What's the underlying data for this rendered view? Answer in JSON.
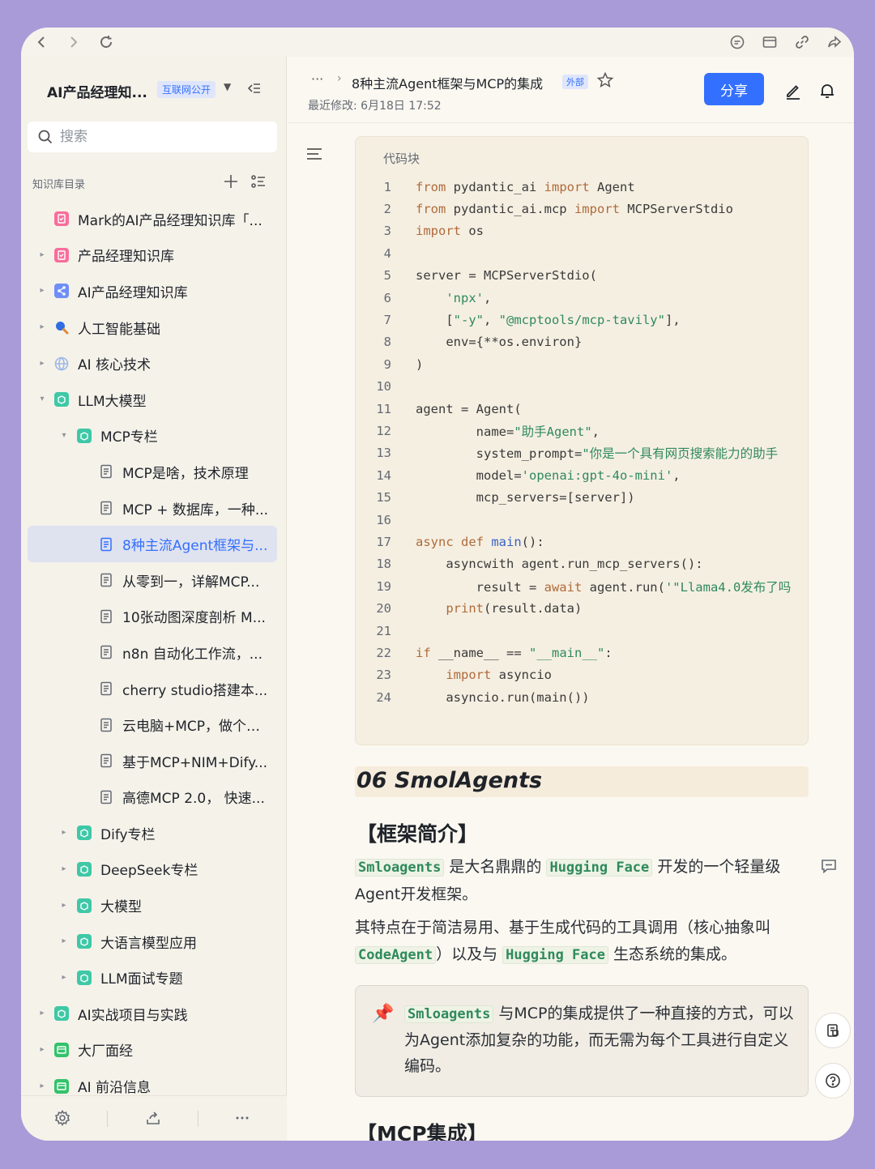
{
  "sidebar": {
    "kb_title": "AI产品经理知...",
    "kb_badge": "互联网公开",
    "search_placeholder": "搜索",
    "dir_title": "知识库目录",
    "items": [
      {
        "label": "Mark的AI产品经理知识库「...",
        "level": 1,
        "icon": "doc-pink-icon",
        "color": "#f76e9b",
        "arrow": ""
      },
      {
        "label": "产品经理知识库",
        "level": 1,
        "icon": "doc-pink-icon",
        "color": "#f76e9b",
        "arrow": "▸"
      },
      {
        "label": "AI产品经理知识库",
        "level": 1,
        "icon": "share-node-icon",
        "color": "#6f8ef7",
        "arrow": "▸"
      },
      {
        "label": "人工智能基础",
        "level": 1,
        "icon": "magnifier-icon",
        "color": "#2f6de0",
        "arrow": "▸"
      },
      {
        "label": "AI 核心技术",
        "level": 1,
        "icon": "globe-icon",
        "color": "#9db8e8",
        "arrow": "▸"
      },
      {
        "label": "LLM大模型",
        "level": 1,
        "icon": "folder-green-icon",
        "color": "#3ec8a6",
        "arrow": "▾"
      },
      {
        "label": "MCP专栏",
        "level": 2,
        "icon": "folder-green-icon",
        "color": "#3ec8a6",
        "arrow": "▾"
      },
      {
        "label": "MCP是啥，技术原理",
        "level": 3,
        "icon": "doc-icon",
        "color": "",
        "arrow": ""
      },
      {
        "label": "MCP + 数据库，一种...",
        "level": 3,
        "icon": "doc-icon",
        "color": "",
        "arrow": ""
      },
      {
        "label": "8种主流Agent框架与...",
        "level": 3,
        "icon": "doc-icon",
        "color": "#3370ff",
        "arrow": "",
        "active": true
      },
      {
        "label": "从零到一，详解MCP...",
        "level": 3,
        "icon": "doc-icon",
        "color": "",
        "arrow": ""
      },
      {
        "label": "10张动图深度剖析 M...",
        "level": 3,
        "icon": "doc-icon",
        "color": "",
        "arrow": ""
      },
      {
        "label": "n8n 自动化工作流，...",
        "level": 3,
        "icon": "doc-icon",
        "color": "",
        "arrow": ""
      },
      {
        "label": "cherry studio搭建本...",
        "level": 3,
        "icon": "doc-icon",
        "color": "",
        "arrow": ""
      },
      {
        "label": "云电脑+MCP，做个m...",
        "level": 3,
        "icon": "doc-icon",
        "color": "",
        "arrow": ""
      },
      {
        "label": "基于MCP+NIM+Dify...",
        "level": 3,
        "icon": "doc-icon",
        "color": "",
        "arrow": ""
      },
      {
        "label": "高德MCP 2.0， 快速...",
        "level": 3,
        "icon": "doc-icon",
        "color": "",
        "arrow": ""
      },
      {
        "label": "Dify专栏",
        "level": 2,
        "icon": "folder-green-icon",
        "color": "#3ec8a6",
        "arrow": "▸"
      },
      {
        "label": "DeepSeek专栏",
        "level": 2,
        "icon": "folder-green-icon",
        "color": "#3ec8a6",
        "arrow": "▸"
      },
      {
        "label": "大模型",
        "level": 2,
        "icon": "folder-green-icon",
        "color": "#3ec8a6",
        "arrow": "▸"
      },
      {
        "label": "大语言模型应用",
        "level": 2,
        "icon": "folder-green-icon",
        "color": "#3ec8a6",
        "arrow": "▸"
      },
      {
        "label": "LLM面试专题",
        "level": 2,
        "icon": "folder-green-icon",
        "color": "#3ec8a6",
        "arrow": "▸"
      },
      {
        "label": "AI实战项目与实践",
        "level": 1,
        "icon": "folder-green-icon",
        "color": "#3ec8a6",
        "arrow": "▸"
      },
      {
        "label": "大厂面经",
        "level": 1,
        "icon": "calendar-green-icon",
        "color": "#34c26b",
        "arrow": "▸"
      },
      {
        "label": "AI 前沿信息",
        "level": 1,
        "icon": "calendar-green-icon",
        "color": "#34c26b",
        "arrow": "▸"
      }
    ]
  },
  "header": {
    "breadcrumb_more": "···",
    "title": "8种主流Agent框架与MCP的集成",
    "badge": "外部",
    "modified": "最近修改: 6月18日 17:52",
    "share_label": "分享"
  },
  "code_block": {
    "label": "代码块",
    "lines": [
      {
        "n": "1",
        "html": "<span class=\"kw\">from</span> pydantic_ai <span class=\"kw\">import</span> Agent"
      },
      {
        "n": "2",
        "html": "<span class=\"kw\">from</span> pydantic_ai.mcp <span class=\"kw\">import</span> MCPServerStdio"
      },
      {
        "n": "3",
        "html": "<span class=\"kw\">import</span> os"
      },
      {
        "n": "4",
        "html": ""
      },
      {
        "n": "5",
        "html": "server = MCPServerStdio("
      },
      {
        "n": "6",
        "html": "    <span class=\"st\">'npx'</span>,"
      },
      {
        "n": "7",
        "html": "    [<span class=\"st\">\"-y\"</span>, <span class=\"st\">\"@mcptools/mcp-tavily\"</span>],"
      },
      {
        "n": "8",
        "html": "    env={**os.environ}"
      },
      {
        "n": "9",
        "html": ")"
      },
      {
        "n": "10",
        "html": ""
      },
      {
        "n": "11",
        "html": "agent = Agent("
      },
      {
        "n": "12",
        "html": "        name=<span class=\"st\">\"助手Agent\"</span>,"
      },
      {
        "n": "13",
        "html": "        system_prompt=<span class=\"st\">\"你是一个具有网页搜索能力的助手</span>"
      },
      {
        "n": "14",
        "html": "        model=<span class=\"st\">'openai:gpt-4o-mini'</span>,"
      },
      {
        "n": "15",
        "html": "        mcp_servers=[server])"
      },
      {
        "n": "16",
        "html": ""
      },
      {
        "n": "17",
        "html": "<span class=\"kw\">async def</span> <span class=\"fn\">main</span>():"
      },
      {
        "n": "18",
        "html": "    asyncwith agent.run_mcp_servers():"
      },
      {
        "n": "19",
        "html": "        result = <span class=\"kw\">await</span> agent.run(<span class=\"st\">'\"Llama4.0发布了吗</span>"
      },
      {
        "n": "20",
        "html": "    <span class=\"kw\">print</span>(result.data)"
      },
      {
        "n": "21",
        "html": ""
      },
      {
        "n": "22",
        "html": "<span class=\"kw\">if</span> __name__ == <span class=\"st\">\"__main__\"</span>:"
      },
      {
        "n": "23",
        "html": "    <span class=\"kw\">import</span> asyncio"
      },
      {
        "n": "24",
        "html": "    asyncio.run(main())"
      }
    ]
  },
  "article": {
    "h2": "06 SmolAgents",
    "h3_intro": "【框架简介】",
    "p1_code1": "Smloagents",
    "p1_a": " 是大名鼎鼎的 ",
    "p1_code2": "Hugging Face",
    "p1_b": " 开发的一个轻量级Agent开发框架。",
    "p2_a": "其特点在于简洁易用、基于生成代码的工具调用（核心抽象叫",
    "p2_code1": "CodeAgent",
    "p2_b": "）以及与 ",
    "p2_code2": "Hugging Face",
    "p2_c": " 生态系统的集成。",
    "callout_code": "Smloagents",
    "callout_text": " 与MCP的集成提供了一种直接的方式，可以为Agent添加复杂的功能，而无需为每个工具进行自定义编码。",
    "h3_mcp": "【MCP集成】"
  },
  "colors": {
    "accent": "#3370ff",
    "background": "#a99ad8",
    "code_keyword": "#b06a3a",
    "code_string": "#2f8a5b"
  }
}
